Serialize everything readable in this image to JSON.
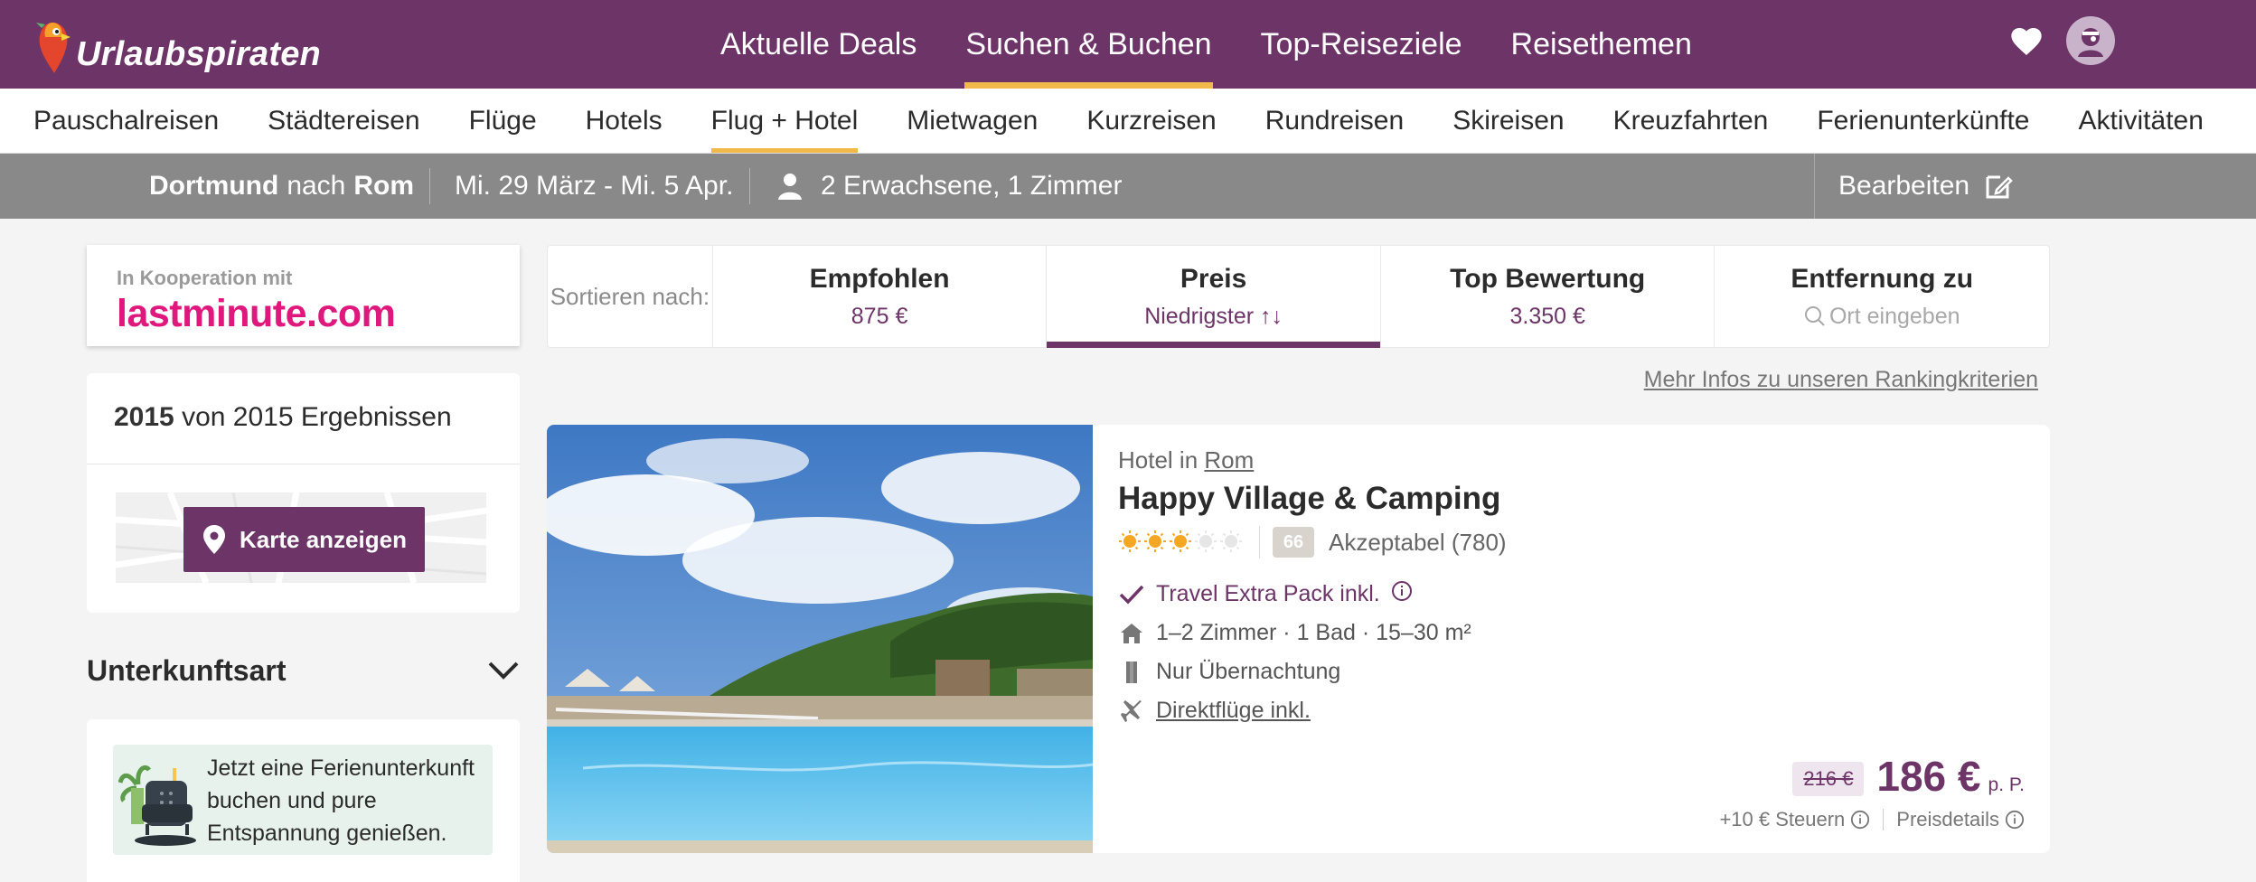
{
  "header": {
    "logo_text": "Urlaubspiraten",
    "nav": [
      {
        "label": "Aktuelle Deals",
        "active": false
      },
      {
        "label": "Suchen & Buchen",
        "active": true
      },
      {
        "label": "Top-Reiseziele",
        "active": false
      },
      {
        "label": "Reisethemen",
        "active": false
      }
    ],
    "icons": [
      "heart-icon",
      "avatar-icon"
    ]
  },
  "subnav": [
    {
      "label": "Pauschalreisen",
      "active": false
    },
    {
      "label": "Städtereisen",
      "active": false
    },
    {
      "label": "Flüge",
      "active": false
    },
    {
      "label": "Hotels",
      "active": false
    },
    {
      "label": "Flug + Hotel",
      "active": true
    },
    {
      "label": "Mietwagen",
      "active": false
    },
    {
      "label": "Kurzreisen",
      "active": false
    },
    {
      "label": "Rundreisen",
      "active": false
    },
    {
      "label": "Skireisen",
      "active": false
    },
    {
      "label": "Kreuzfahrten",
      "active": false
    },
    {
      "label": "Ferienunterkünfte",
      "active": false
    },
    {
      "label": "Aktivitäten",
      "active": false
    }
  ],
  "search_summary": {
    "origin": "Dortmund",
    "connector": "nach",
    "destination": "Rom",
    "dates": "Mi. 29 März - Mi. 5 Apr.",
    "travellers": "2 Erwachsene, 1 Zimmer",
    "edit_label": "Bearbeiten"
  },
  "partner": {
    "label": "In Kooperation mit",
    "brand": "lastminute.com"
  },
  "results": {
    "shown": "2015",
    "text": "von 2015 Ergebnissen",
    "map_button": "Karte anzeigen"
  },
  "filters": {
    "accommodation_title": "Unterkunftsart"
  },
  "promo": {
    "text": "Jetzt eine Ferienunterkunft buchen und pure Entspannung genießen."
  },
  "sort": {
    "label": "Sortieren nach:",
    "tabs": [
      {
        "title": "Empfohlen",
        "value": "875 €",
        "active": false
      },
      {
        "title": "Preis",
        "value": "Niedrigster ↑↓",
        "active": true
      },
      {
        "title": "Top Bewertung",
        "value": "3.350 €",
        "active": false
      },
      {
        "title": "Entfernung zu",
        "value": "Ort eingeben",
        "active": false
      }
    ]
  },
  "ranking_link": "Mehr Infos zu unseren Rankingkriterien",
  "hotel": {
    "kind_prefix": "Hotel in",
    "city": "Rom",
    "name": "Happy Village & Camping",
    "stars": 3,
    "stars_max": 5,
    "score": "66",
    "score_label": "Akzeptabel (780)",
    "features": [
      {
        "icon": "check-icon",
        "text": "Travel Extra Pack inkl."
      },
      {
        "icon": "house-icon",
        "text": "1–2 Zimmer · 1 Bad · 15–30 m²"
      },
      {
        "icon": "door-icon",
        "text": "Nur Übernachtung"
      },
      {
        "icon": "plane-icon",
        "text": "Direktflüge inkl."
      }
    ],
    "old_price": "216 €",
    "price": "186 €",
    "price_unit": "p. P.",
    "taxes": "+10 € Steuern",
    "price_details": "Preisdetails"
  },
  "colors": {
    "brand_purple": "#6c3467",
    "accent_yellow": "#f0b94a",
    "partner_pink": "#e0177c",
    "star_orange": "#f5a623"
  }
}
